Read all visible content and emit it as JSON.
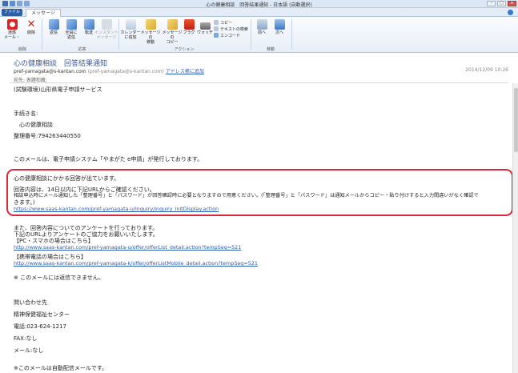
{
  "window": {
    "title": "心の健康相談　回答結果通知 - 日本語 (自動選択)"
  },
  "tabs": {
    "app_button": "ファイル",
    "message_tab": "メッセージ"
  },
  "ribbon": {
    "buttons": {
      "junk": "迷惑\nメール・",
      "delete": "削除",
      "reply": "返信",
      "reply_all": "全員に\n返信",
      "forward": "転送",
      "instant_message": "インスタント\nメッセージ",
      "calendar": "カレンダー\nに追加",
      "move_message": "メッセージの\n移動",
      "copy_message": "メッセージの\nコピー",
      "flag": "フラグ",
      "watch": "ウォッチ",
      "prev": "前へ",
      "next": "次へ"
    },
    "small": {
      "copy": "コピー",
      "find_text": "テキストの検索",
      "encode": "エンコード"
    },
    "groups": {
      "delete": "削除",
      "respond": "応答",
      "actions": "アクション",
      "navigate": "移動"
    }
  },
  "header": {
    "subject": "心の健康相談　回答結果通知",
    "from_address": "pref-yamagata@s-kantan.com",
    "from_paren": "(pref-yamagata@s-kantan.com)",
    "add_contact": "アドレス帳に追加",
    "date": "2014/12/09 10:26",
    "to": "宛先: 表題和蔵;"
  },
  "body": {
    "l1": "(試験環境)山形県電子申請サービス",
    "l2": "手続き名:",
    "l3": "　心の健康相談",
    "l4": "整理番号:794263440550",
    "l5": "このメールは、電子申請システム「やまがた e申請」が発行しております。",
    "h1": "心の健康相談にかかる回答が出ています。",
    "h2": "回答内容は、14日以内に下記URLからご確認ください。",
    "h3": "相談申込時にメール通知した「整理番号」と「パスワード」が回答確認時に必要となりますので用意ください。(「整理番号」と「パスワード」は通知メールからコピー・貼り付けすると入力間違いがなく確認で",
    "h4": "きます。)",
    "h5": "https://www.saas-kantan.com/pref-yamagata-u/inquiry/inquiry_initDisplay.action",
    "s1": "また、回答内容についてのアンケートを行っております。",
    "s2": "下記のURLよりアンケートのご協力をお願いいたします。",
    "s3": "【PC・スマホの場合はこちら】",
    "s4": "http://www.saas-kantan.com/pref-yamagata-u/offer/offerList_detail.action?tempSeq=521",
    "s5": "【携帯電話の場合はこちら】",
    "s6": "http://www.saas-kantan.com/pref-yamagata-k/offer/offerListMobile_detail.action?tempSeq=521",
    "s7": "※ このメールには返信できません。",
    "c1": "問い合わせ先",
    "c2": "精神保健福祉センター",
    "c3": "電話:023-624-1217",
    "c4": "FAX:なし",
    "c5": "メール:なし",
    "c6": "※このメールは自動配信メールです。"
  },
  "colors": {
    "highlight": "#d8283a",
    "link": "#2a5db0",
    "subject": "#3b5998"
  }
}
